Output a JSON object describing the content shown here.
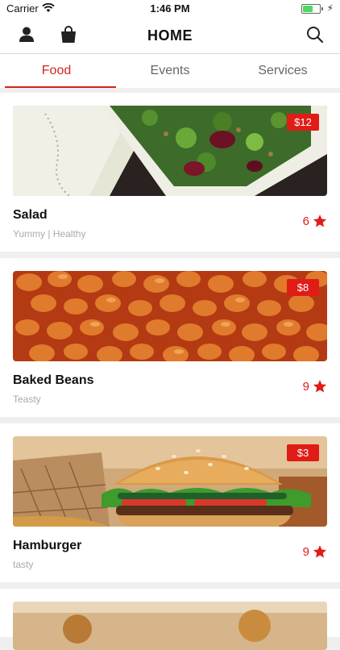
{
  "status_bar": {
    "carrier": "Carrier",
    "time": "1:46 PM"
  },
  "header": {
    "title": "HOME",
    "icons": [
      "user-icon",
      "shopping-bag-icon",
      "search-icon"
    ]
  },
  "tabs": [
    {
      "label": "Food",
      "active": true
    },
    {
      "label": "Events",
      "active": false
    },
    {
      "label": "Services",
      "active": false
    }
  ],
  "items": [
    {
      "name": "Salad",
      "tags": "Yummy | Healthy",
      "price": "$12",
      "rating": "6"
    },
    {
      "name": "Baked Beans",
      "tags": "Teasty",
      "price": "$8",
      "rating": "9"
    },
    {
      "name": "Hamburger",
      "tags": "tasty",
      "price": "$3",
      "rating": "9"
    }
  ],
  "colors": {
    "accent": "#d0261d",
    "price_badge": "#e11b16",
    "star": "#e11b16"
  }
}
